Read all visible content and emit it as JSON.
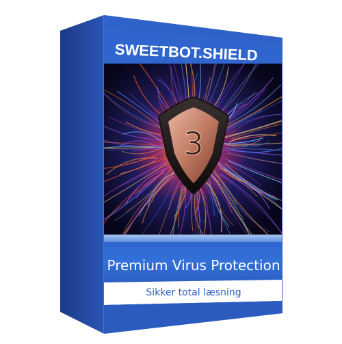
{
  "product": {
    "brand": "SWEETBOT.SHIELD",
    "badge_number": "3",
    "tagline": "Premium Virus Protection",
    "subtitle": "Sikker total læsning"
  },
  "colors": {
    "box_blue": "#2b5fc2",
    "box_blue_dark": "#1c3f8e",
    "white_band": "#ffffff",
    "shield_copper": "#c0806a",
    "artwork_bg": "#0a0818"
  },
  "icons": {
    "badge": "shield-icon"
  }
}
